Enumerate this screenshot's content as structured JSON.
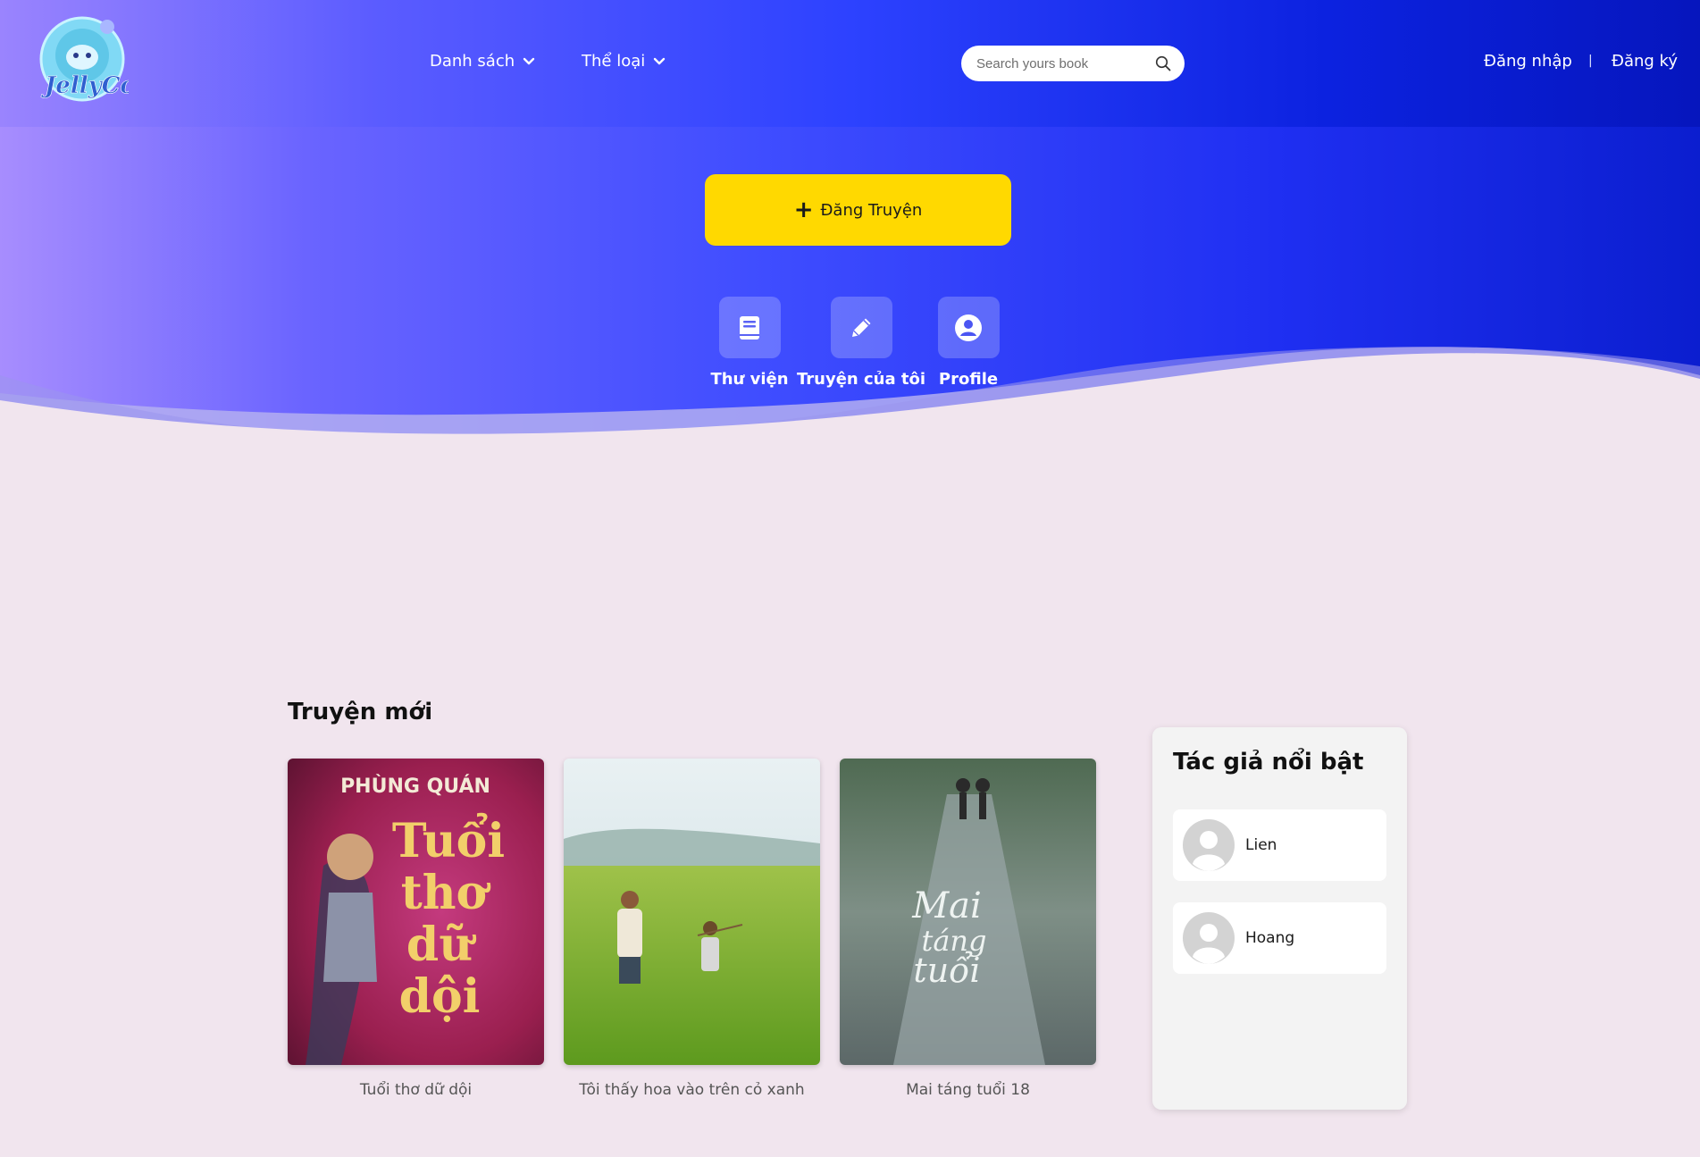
{
  "header": {
    "logo_text": "JellyCo",
    "nav": [
      {
        "label": "Danh sách"
      },
      {
        "label": "Thể loại"
      }
    ],
    "search_placeholder": "Search yours book",
    "login_label": "Đăng nhập",
    "separator": "|",
    "register_label": "Đăng ký"
  },
  "hero": {
    "post_button_label": "Đăng Truyện",
    "post_button_icon": "plus-icon",
    "quick_links": [
      {
        "label": "Thư viện",
        "icon": "book-icon"
      },
      {
        "label": "Truyện của tôi",
        "icon": "pencil-icon"
      },
      {
        "label": "Profile",
        "icon": "user-circle-icon"
      }
    ]
  },
  "new_stories": {
    "title": "Truyện mới",
    "books": [
      {
        "title": "Tuổi thơ dữ dội",
        "cover_author": "PHÙNG QUÁN",
        "cover_title_lines": [
          "Tuổi",
          "thơ",
          "dữ",
          "dội"
        ]
      },
      {
        "title": "Tôi thấy hoa vào trên cỏ xanh"
      },
      {
        "title": "Mai táng tuổi 18",
        "cover_title_lines": [
          "Mai",
          "táng",
          "tuổi"
        ]
      }
    ]
  },
  "featured_authors": {
    "title": "Tác giả nổi bật",
    "authors": [
      {
        "name": "Lien"
      },
      {
        "name": "Hoang"
      }
    ]
  },
  "colors": {
    "accent_yellow": "#ffd900",
    "background": "#f1e5ee",
    "hero_blue": "#1f2ff2"
  }
}
